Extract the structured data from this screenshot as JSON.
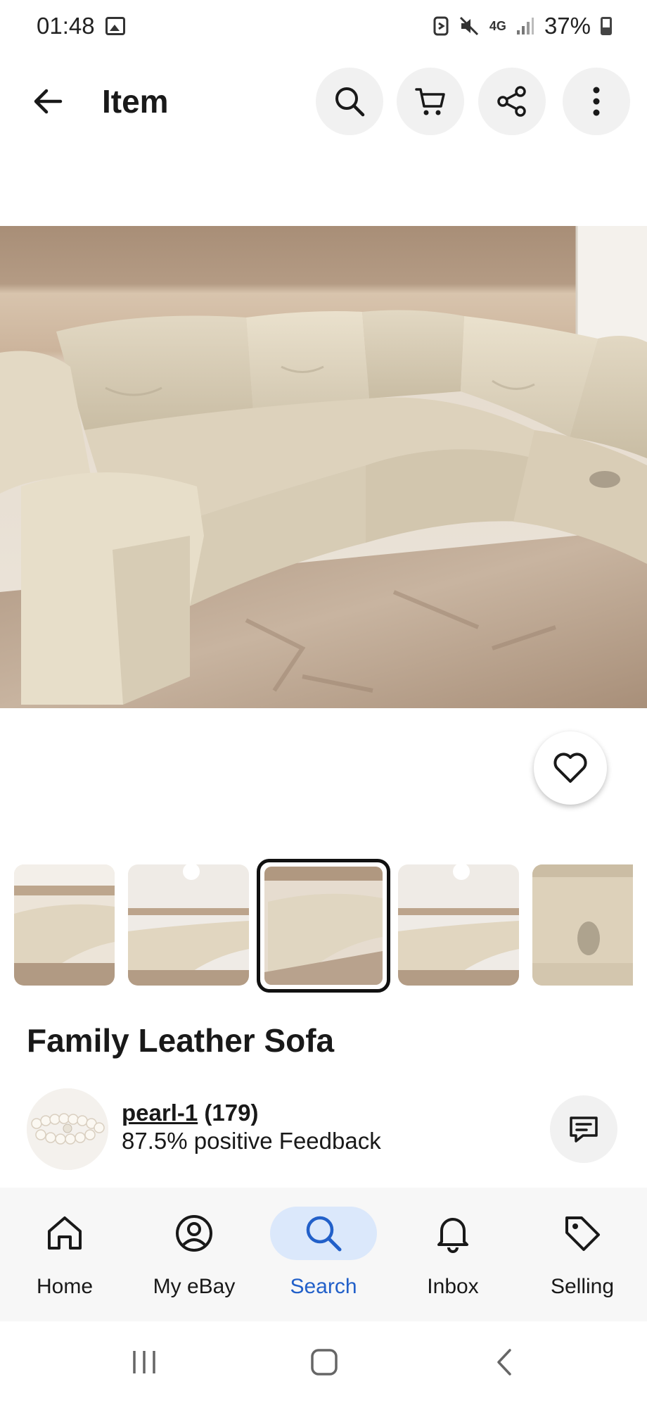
{
  "status_bar": {
    "time": "01:48",
    "network": "4G",
    "battery": "37%"
  },
  "header": {
    "title": "Item",
    "icons": [
      "back-arrow-icon",
      "search-icon",
      "cart-icon",
      "share-icon",
      "more-vertical-icon"
    ]
  },
  "listing": {
    "title": "Family Leather Sofa",
    "selected_thumbnail": 3,
    "thumbnail_count": 5
  },
  "seller": {
    "username": "pearl-1",
    "feedback_count": "(179)",
    "feedback_text": "87.5% positive Feedback"
  },
  "bottom_nav": {
    "items": [
      {
        "label": "Home",
        "icon": "home-icon"
      },
      {
        "label": "My eBay",
        "icon": "profile-icon"
      },
      {
        "label": "Search",
        "icon": "search-icon",
        "active": true
      },
      {
        "label": "Inbox",
        "icon": "bell-icon"
      },
      {
        "label": "Selling",
        "icon": "tag-icon"
      }
    ]
  },
  "colors": {
    "accent": "#2260c9",
    "active_pill": "#dbe8fb",
    "button_bg": "#f1f1f1",
    "nav_bg": "#f7f7f7"
  }
}
